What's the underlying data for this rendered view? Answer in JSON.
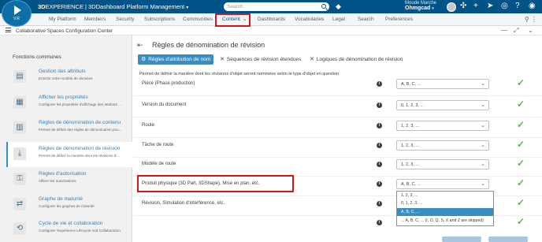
{
  "topbar": {
    "logo_version": "V.R",
    "brand_bold": "3D",
    "brand_rest": "EXPERIENCE | 3DDashboard",
    "brand_app": "Platform Management",
    "search_placeholder": "Search",
    "user_name": "Moude Marche",
    "tenant": "Ohmgcad"
  },
  "nav": {
    "items": [
      "My Platform",
      "Members",
      "Security",
      "Subscriptions",
      "Communities",
      "Content",
      "Dashboards",
      "Vocabularies",
      "Legal",
      "Search",
      "Preferences"
    ],
    "active": "Content"
  },
  "breadcrumb": "Collaborative Spaces Configuration Center",
  "sidebar": {
    "section": "Fonctions communes",
    "items": [
      {
        "title": "Gestion des attributs",
        "desc": "Enrichir votre modèle de données",
        "icon": "attributes-icon"
      },
      {
        "title": "Afficher les propriétés",
        "desc": "Configurer les propriétés d'affichage des attributs ...",
        "icon": "properties-icon"
      },
      {
        "title": "Règles de dénomination de contenu",
        "desc": "Permet de définir des règles de dénomination pou...",
        "icon": "naming-icon"
      },
      {
        "title": "Règles de dénomination de révision",
        "desc": "Permet de définir la manière dont les révisions d'...",
        "icon": "revision-icon"
      },
      {
        "title": "Règles d'autorisation",
        "desc": "Affiner les autorisations",
        "icon": "authorization-icon"
      },
      {
        "title": "Graphe de maturité",
        "desc": "Configurer les graphes de maturité",
        "icon": "maturity-icon"
      },
      {
        "title": "Cycle de vie et collaboration",
        "desc": "Configurer l'expérience Lifecycle And Collaboration",
        "icon": "lifecycle-icon"
      }
    ]
  },
  "main": {
    "title": "Règles de dénomination de révision",
    "tabs": [
      "Règles d'attribution de nom",
      "Séquences de révision étendues",
      "Logiques de dénomination de révision"
    ],
    "intro": "Permet de définir la manière dont les révisions d'objet seront nommées selon le type d'objet en question",
    "rows": [
      {
        "label": "Pièce (Phase production)",
        "value": "A, B, C, ..."
      },
      {
        "label": "Version du document",
        "value": "0, 1, 2, 3, ..."
      },
      {
        "label": "Route",
        "value": "1, 2, 3, ..."
      },
      {
        "label": "Tâche de route",
        "value": "1, 2, 3, ..."
      },
      {
        "label": "Modèle de route",
        "value": "1, 2, 3, ..."
      },
      {
        "label": "Produit physique (3D Part, 3DShape), Mise en plan, etc.",
        "value": "A, B, C, ..."
      },
      {
        "label": "Révision, Simulation d'interférence, etc.",
        "value": ""
      },
      {
        "label": "",
        "value": ""
      }
    ],
    "dropdown_options": [
      "1, 2, 3, ...",
      "0, 1, 2, 3, ...",
      "A, B, C, ...",
      "... A, B, C, ... (I, O, Q, S, X and Z are skipped)"
    ],
    "dropdown_selected": 2
  }
}
